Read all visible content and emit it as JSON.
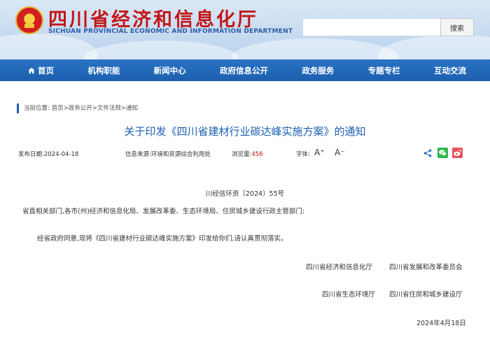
{
  "header": {
    "site_title": "四川省经济和信息化厅",
    "site_subtitle": "SICHUAN PROVINCIAL ECONOMIC AND INFORMATION DEPARTMENT",
    "search_placeholder": "",
    "search_label": "搜索"
  },
  "nav": {
    "items": [
      {
        "label": "首页"
      },
      {
        "label": "机构职能"
      },
      {
        "label": "新闻中心"
      },
      {
        "label": "政府信息公开"
      },
      {
        "label": "政务服务"
      },
      {
        "label": "专题专栏"
      },
      {
        "label": "互动交流"
      }
    ]
  },
  "breadcrumb": {
    "prefix": "当前位置:",
    "items": [
      "首页",
      "政务公开",
      "文件法规",
      "通知"
    ],
    "separator": ">"
  },
  "article": {
    "title": "关于印发《四川省建材行业碳达峰实施方案》的通知",
    "publish_date": "发布日期:2024-04-18",
    "source": "信息来源:环境和资源综合利用处",
    "views_label": "浏览量:",
    "views": "456",
    "font_label": "字体:",
    "font_up": "A⁺",
    "font_down": "A⁻",
    "doc_number": "川经信环资〔2024〕55号",
    "addressee": "省直相关部门,各市(州)经济和信息化局、发展改革委、生态环境局、住房城乡建设行政主管部门:",
    "body": "经省政府同意,现将《四川省建材行业碳达峰实施方案》印发给你们,请认真贯彻落实。",
    "signatures": [
      "四川省经济和信息化厅",
      "四川省发展和改革委员会",
      "四川省生态环境厅",
      "四川省住房和城乡建设厅"
    ],
    "sign_date": "2024年4月18日"
  },
  "colors": {
    "title_red": "#c41616",
    "nav_blue": "#1c5fae",
    "wechat_green": "#2fb84a",
    "weibo_red": "#e8525b"
  },
  "icons": {
    "home": "home-icon",
    "share": "share-icon",
    "wechat": "wechat-icon",
    "weibo": "weibo-icon",
    "emblem": "national-emblem-icon"
  }
}
